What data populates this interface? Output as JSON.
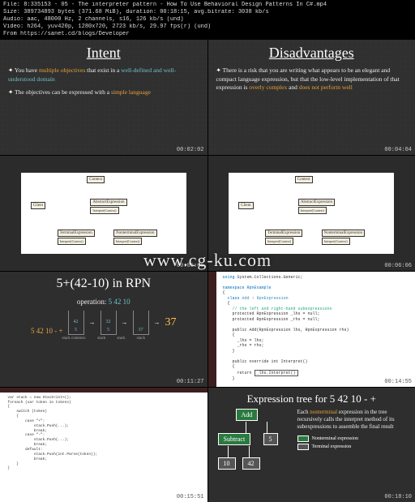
{
  "meta": {
    "file": "File: 8:335153 - 05 - The interpreter pattern - How To Use Behavioral Design Patterns In C#.mp4",
    "size": "Size: 389734893 bytes (371.68 MiB), duration: 00:18:15, avg.bitrate: 3038 kb/s",
    "audio": "Audio: aac, 48000 Hz, 2 channels, s16, 126 kb/s (und)",
    "video": "Video: h264, yuv420p, 1280x720, 2723 kb/s, 29.97 fps(r) (und)",
    "from": "From https://sanet.cd/blogs/Developer"
  },
  "watermark": "www.cg-ku.com",
  "panels": {
    "intent": {
      "title": "Intent",
      "bullet1a": "You have ",
      "bullet1b": "multiple objectives",
      "bullet1c": " that exist in a ",
      "bullet1d": "well-defined and well-understood domain",
      "bullet2a": "The objectives can be expressed with a ",
      "bullet2b": "simple language",
      "ts": "00:02:02"
    },
    "disadv": {
      "title": "Disadvantages",
      "line1": "There is a risk that you are writing what appears to be an elegant and compact language expression, but that the low-level implementation of that expression is ",
      "hl1": "overly complex",
      "mid": " and ",
      "hl2": "does not perform well",
      "ts": "00:04:04"
    },
    "uml": {
      "context": "Context",
      "client": "Client",
      "abstract": "AbstractExpression",
      "interpret": "Interpret(Context)",
      "terminal": "TerminalExpression",
      "nonterminal": "NonterminalExpression",
      "ts1": "00:05:05",
      "ts2": "00:06:06"
    },
    "rpn": {
      "title": "5+(42-10) in RPN",
      "op_label": "operation:",
      "op_val": "5 42 10",
      "input": "5 42 10 - +",
      "stack1_a": "42",
      "stack1_b": "5",
      "stack2_a": "32",
      "stack2_b": "5",
      "stack3_a": "37",
      "result": "37",
      "stack_label": "stack contents:",
      "sub_label": "stack",
      "ts": "00:11:27"
    },
    "code": {
      "ns": "namespace RpnExample",
      "cls": "class Add : RpnExpression",
      "comment": "// the left and right-hand subexpressions",
      "f1": "protected RpnExpression _lhs = null;",
      "f2": "protected RpnExpression _rhs = null;",
      "ctor": "public Add(RpnExpression lhs, RpnExpression rhs)",
      "b1": "_lhs = lhs;",
      "b2": "_rhs = rhs;",
      "method": "public override int Interpret()",
      "ret": "return ",
      "retcall": "_lhs.Interpret()",
      "ts": "00:14:55"
    },
    "ide": {
      "ts": "00:15:51"
    },
    "etree": {
      "title": "Expression tree for 5 42 10 - +",
      "add": "Add",
      "subtract": "Subtract",
      "n5": "5",
      "n10": "10",
      "n42": "42",
      "desc1": "Each ",
      "desc_hl1": "nonterminal",
      "desc2": " expression in the tree recursively calls the interpret method of its subexpressions to assemble the final result",
      "legend_nt": "Nonterminal expression",
      "legend_t": "Terminal expression",
      "ts": "00:18:10"
    }
  }
}
